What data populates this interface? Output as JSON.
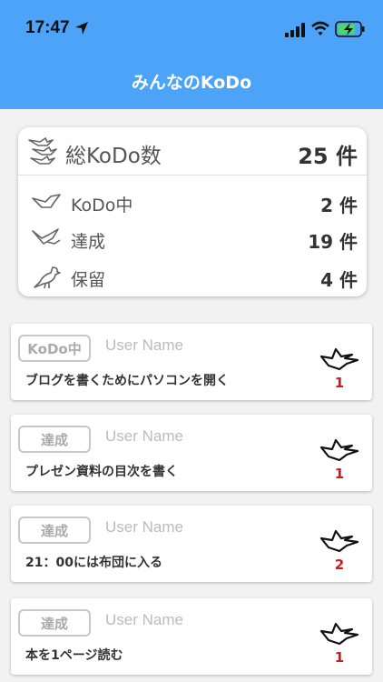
{
  "status_bar": {
    "time": "17:47"
  },
  "header": {
    "title": "みんなのKoDo"
  },
  "summary": {
    "total": {
      "label": "総KoDo数",
      "value": "25 件"
    },
    "rows": [
      {
        "label": "KoDo中",
        "value": "2 件"
      },
      {
        "label": "達成",
        "value": "19 件"
      },
      {
        "label": "保留",
        "value": "4 件"
      }
    ]
  },
  "cards": [
    {
      "badge": "KoDo中",
      "user": "User Name",
      "title": "ブログを書くためにパソコンを開く",
      "count": "1"
    },
    {
      "badge": "達成",
      "user": "User Name",
      "title": "プレゼン資料の目次を書く",
      "count": "1"
    },
    {
      "badge": "達成",
      "user": "User Name",
      "title": "21：00には布団に入る",
      "count": "2"
    },
    {
      "badge": "達成",
      "user": "User Name",
      "title": "本を1ページ読む",
      "count": "1"
    }
  ],
  "colors": {
    "header": "#4da3f7",
    "count": "#d21a1a",
    "badge_border": "#c8c8c8"
  }
}
